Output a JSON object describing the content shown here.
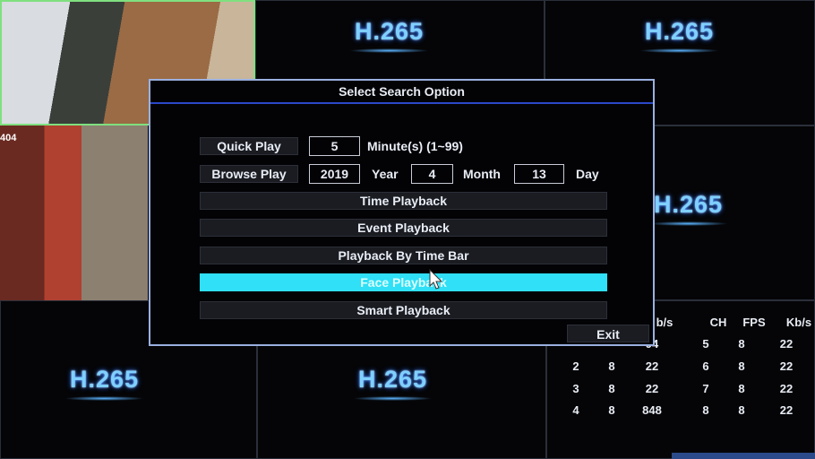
{
  "background": {
    "logo_text": "H.265",
    "camera_label": "404"
  },
  "dialog": {
    "title": "Select Search Option",
    "quick_play": {
      "label": "Quick Play",
      "value": "5",
      "unit": "Minute(s)",
      "range": "(1~99)"
    },
    "browse_play": {
      "label": "Browse Play",
      "year": "2019",
      "year_label": "Year",
      "month": "4",
      "month_label": "Month",
      "day": "13",
      "day_label": "Day"
    },
    "options": [
      "Time Playback",
      "Event Playback",
      "Playback By Time Bar",
      "Face Playback",
      "Smart Playback"
    ],
    "selected_option": "Face Playback",
    "exit_label": "Exit",
    "accent_color": "#2fe0f6"
  },
  "stats": {
    "headers": [
      "b/s",
      "CH",
      "FPS",
      "Kb/s"
    ],
    "rows": [
      [
        "",
        "",
        "94",
        "5",
        "8",
        "22"
      ],
      [
        "2",
        "8",
        "22",
        "6",
        "8",
        "22"
      ],
      [
        "3",
        "8",
        "22",
        "7",
        "8",
        "22"
      ],
      [
        "4",
        "8",
        "848",
        "8",
        "8",
        "22"
      ]
    ]
  }
}
